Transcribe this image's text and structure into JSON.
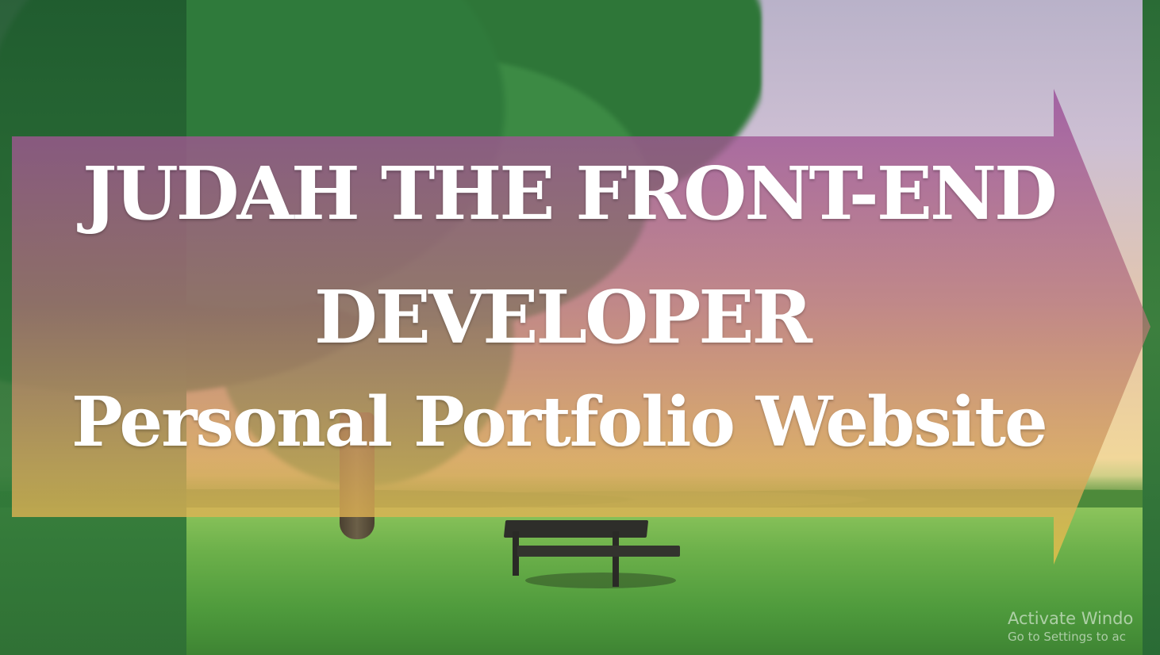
{
  "hero": {
    "title_line_1": "JUDAH THE FRONT-END",
    "title_line_2": "DEVELOPER",
    "subtitle": "Personal Portfolio Website"
  },
  "banner": {
    "gradient_top": "#9b4f9a",
    "gradient_mid": "#b3707a",
    "gradient_bottom": "#e9c24a"
  },
  "watermark": {
    "title": "Activate Windo",
    "subtitle": "Go to Settings to ac"
  }
}
